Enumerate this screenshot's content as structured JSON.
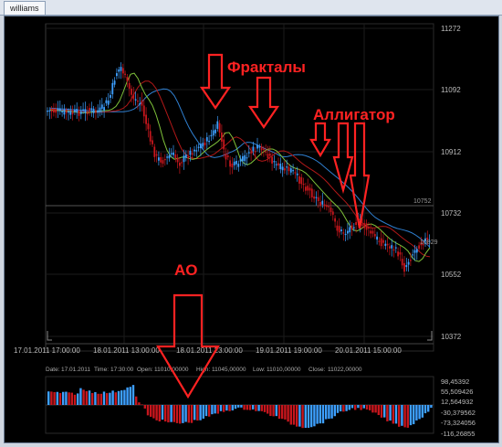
{
  "window": {
    "tab_title": "williams"
  },
  "price_chart": {
    "y_ticks": [
      "11272",
      "11092",
      "10912",
      "10732",
      "10552",
      "10372"
    ],
    "price_marker_a": "10752",
    "price_marker_b": "10829",
    "x_labels": [
      "17.01.2011 17:00:00",
      "18.01.2011 13:00:00",
      "18.01.2011 23:00:00",
      "19.01.2011 19:00:00",
      "20.01.2011 15:00:00"
    ]
  },
  "info_bar": {
    "date_label": "Date:",
    "date": "17.01.2011",
    "time_label": "Time:",
    "time": "17:30:00",
    "open_label": "Open:",
    "open": "11010,00000",
    "high_label": "High:",
    "high": "11045,00000",
    "low_label": "Low:",
    "low": "11010,00000",
    "close_label": "Close:",
    "close": "11022,00000"
  },
  "oscillator": {
    "ticks": [
      "98,45392",
      "55,509426",
      "12,564932",
      "-30,379562",
      "-73,324056",
      "-116,26855"
    ]
  },
  "annotations": {
    "fractals": "Фракталы",
    "alligator": "Аллигатор",
    "ao": "AO"
  },
  "colors": {
    "background": "#000000",
    "up_candle": "#3d9fff",
    "down_candle": "#c8161d",
    "jaw": "#2f7fd0",
    "teeth": "#b01818",
    "lips": "#7fc23a",
    "annotation": "#ff2222",
    "axis_text": "#bbbbbb"
  }
}
